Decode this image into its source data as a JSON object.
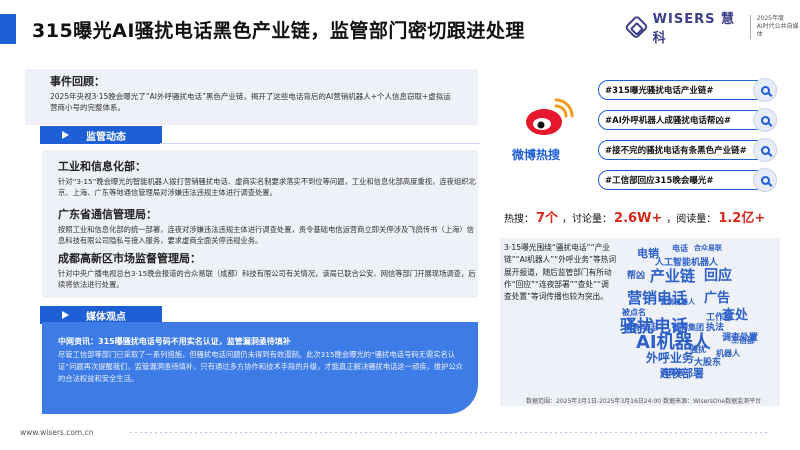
{
  "header": {
    "title": "315曝光AI骚扰电话黑色产业链，监管部门密切跟进处理",
    "logo_text": "WISERS 慧科",
    "logo_sub_line1": "2025年度",
    "logo_sub_line2": "AI时代公共自媒体"
  },
  "event": {
    "title": "事件回顾：",
    "text": "2025年央视3·15晚会曝光了“AI外呼骚扰电话”黑色产业链，揭开了这些电话背后的AI营销机器人+个人信息窃取+虚拟运营商小号的完整体系。"
  },
  "sections": {
    "regulatory": "监管动态",
    "media": "媒体观点"
  },
  "regulators": [
    {
      "head": "工业和信息化部：",
      "text": "针对“3·15”晚会曝光的智能机器人拨打营销骚扰电话、虚商实名制要求落实不到位等问题，工业和信息化部高度重视，连夜组织北京、上海、广东等地通信管理局对涉嫌违法违规主体进行调查处置。"
    },
    {
      "head": "广东省通信管理局：",
      "text": "按照工业和信息化部的统一部署，连夜对涉嫌违法违规主体进行调查处置，责令基础电信运营商立即关停涉及飞鸽传书（上海）信息科技有限公司隐私号接入服务，要求虚商全面关停违规业务。"
    },
    {
      "head": "成都高新区市场监督管理局：",
      "text": "针对中央广播电视总台3·15晚会报道的合众易联（成都）科技有限公司有关情况，该局已联合公安、网信等部门开展现场调查，后续将依法进行处置。"
    }
  ],
  "media": {
    "head": "中网资讯：315曝骚扰电话号码不用实名认证，监管漏洞亟待填补",
    "text": "尽管工信部等部门已采取了一系列措施，但骚扰电话问题仍未得到有效遏制。此次315晚会曝光的“骚扰电话号码无需实名认证”问题再次提醒我们，监管漏洞亟待填补，只有通过多方协作和技术手段的升级，才能真正解决骚扰电话这一顽疾，维护公众的合法权益和安全生活。"
  },
  "weibo": {
    "label": "微博热搜",
    "topics": [
      "#315曝光骚扰电话产业链#",
      "#AI外呼机器人成骚扰电话帮凶#",
      "#接不完的骚扰电话有条黑色产业链#",
      "#工信部回应315晚会曝光#"
    ],
    "stats": {
      "heat_label": "热搜：",
      "heat_value": "7个",
      "discuss_label": "，讨论量：",
      "discuss_value": "2.6W+",
      "read_label": "，阅读量：",
      "read_value": "1.2亿+"
    }
  },
  "cloud": {
    "summary": "3·15曝光围绕“骚扰电话”“产业链”“AI机器人”“外呼业务”等热词展开报道，随后监管部门有所动作“回应”“连夜部署”“查处”“调查处置”等词传播也较为突出。",
    "words": [
      {
        "text": "骚扰电话",
        "color": "#2c5fc9"
      },
      {
        "text": "产业链",
        "color": "#2c5fc9"
      },
      {
        "text": "回应",
        "color": "#2c5fc9"
      },
      {
        "text": "营销电话",
        "color": "#2c5fc9"
      },
      {
        "text": "广告",
        "color": "#2c5fc9"
      },
      {
        "text": "查处",
        "color": "#2c5fc9"
      },
      {
        "text": "AI机器人",
        "color": "#2c5fc9"
      },
      {
        "text": "外呼业务",
        "color": "#2c5fc9"
      },
      {
        "text": "连夜部署",
        "color": "#2c5fc9"
      },
      {
        "text": "执法",
        "color": "#2c5fc9"
      },
      {
        "text": "工作部",
        "color": "#2c5fc9"
      },
      {
        "text": "调查处置",
        "color": "#2c5fc9"
      },
      {
        "text": "人工智能机器人",
        "color": "#2c5fc9"
      },
      {
        "text": "电销",
        "color": "#2c5fc9"
      },
      {
        "text": "帮凶",
        "color": "#2c5fc9"
      },
      {
        "text": "被点名",
        "color": "#2c5fc9"
      },
      {
        "text": "销售电话",
        "color": "#2c5fc9"
      },
      {
        "text": "微腾集团",
        "color": "#2c5fc9"
      },
      {
        "text": "消费者",
        "color": "#2c5fc9"
      },
      {
        "text": "大股东",
        "color": "#2c5fc9"
      },
      {
        "text": "电话",
        "color": "#2c5fc9"
      },
      {
        "text": "合众易联",
        "color": "#2c5fc9"
      },
      {
        "text": "营销机器人",
        "color": "#2c5fc9"
      },
      {
        "text": "骚扰",
        "color": "#2c5fc9"
      },
      {
        "text": "机器人",
        "color": "#2c5fc9"
      },
      {
        "text": "工信部",
        "color": "#2c5fc9"
      }
    ]
  },
  "source": "数据范围：2025年3月1日-2025年3月16日24:00  数据来源：WisersOne数据监测平台",
  "footer_url": "www.wisers.com.cn",
  "colors": {
    "accent": "#1f5fd6",
    "highlight": "#d9281c",
    "panel": "#eef1f7"
  }
}
